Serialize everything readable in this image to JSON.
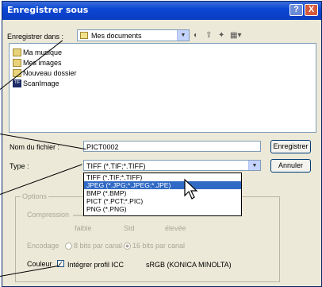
{
  "window": {
    "title": "Enregistrer sous",
    "help_glyph": "?",
    "close_glyph": "X"
  },
  "save_in": {
    "label": "Enregistrer dans :",
    "value": "Mes documents"
  },
  "files": [
    {
      "name": "Ma musique",
      "icon": "folder-icon"
    },
    {
      "name": "Mes images",
      "icon": "folder-icon"
    },
    {
      "name": "Nouveau dossier",
      "icon": "folder-icon"
    },
    {
      "name": "ScanImage",
      "icon": "app-icon",
      "icon_text": "TIF"
    }
  ],
  "filename": {
    "label": "Nom du fichier :",
    "value": "PICT0002"
  },
  "type": {
    "label": "Type :",
    "value": "TIFF (*.TIF;*.TIFF)"
  },
  "type_options": [
    "TIFF (*.TIF;*.TIFF)",
    "JPEG (*.JPG;*.JPEG;*.JPE)",
    "BMP (*.BMP)",
    "PICT (*.PCT;*.PIC)",
    "PNG (*.PNG)"
  ],
  "selected_option_index": 1,
  "buttons": {
    "save": "Enregistrer",
    "cancel": "Annuler"
  },
  "options": {
    "title": "Options",
    "compression_label": "Compression",
    "compression_low": "faible",
    "compression_std": "Std",
    "compression_high": "élevée",
    "encoding_label": "Encodage",
    "encoding_8": "8 bits par canal",
    "encoding_16": "16 bits par canal",
    "color_label": "Couleur",
    "icc_label": "Intégrer profil ICC",
    "icc_profile": "sRGB (KONICA MINOLTA)",
    "icc_checked": true
  }
}
